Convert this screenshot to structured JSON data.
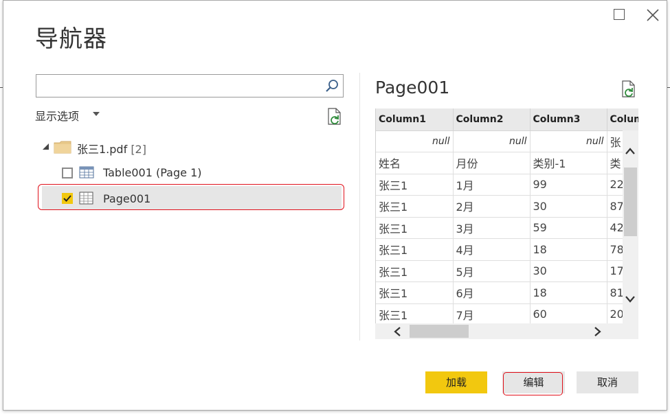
{
  "dialog": {
    "title": "导航器"
  },
  "search": {
    "value": "",
    "placeholder": ""
  },
  "display_options": {
    "label": "显示选项"
  },
  "tree": {
    "root": {
      "label": "张三1.pdf",
      "count": "[2]"
    },
    "items": [
      {
        "label": "Table001 (Page 1)",
        "checked": false,
        "icon": "table-icon"
      },
      {
        "label": "Page001",
        "checked": true,
        "icon": "page-icon"
      }
    ]
  },
  "preview": {
    "title": "Page001",
    "columns": [
      "Column1",
      "Column2",
      "Column3",
      "Colum"
    ],
    "rows": [
      [
        "null",
        "null",
        "null",
        "张"
      ],
      [
        "姓名",
        "月份",
        "类别-1",
        "类"
      ],
      [
        "张三1",
        "1月",
        "99",
        "22"
      ],
      [
        "张三1",
        "2月",
        "30",
        "87"
      ],
      [
        "张三1",
        "3月",
        "59",
        "42"
      ],
      [
        "张三1",
        "4月",
        "18",
        "78"
      ],
      [
        "张三1",
        "5月",
        "30",
        "17"
      ],
      [
        "张三1",
        "6月",
        "18",
        "81"
      ],
      [
        "张三1",
        "7月",
        "60",
        "20"
      ]
    ]
  },
  "buttons": {
    "load": "加载",
    "edit": "编辑",
    "cancel": "取消"
  },
  "colors": {
    "accent": "#f2c80f",
    "highlight_outline": "#e0101a",
    "selected_row": "#e6e6e6"
  }
}
